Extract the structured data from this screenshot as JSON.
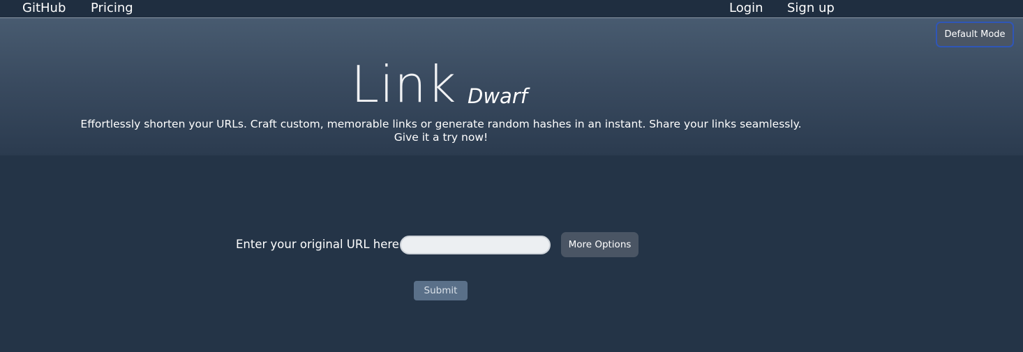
{
  "nav": {
    "left_links": [
      "GitHub",
      "Pricing"
    ],
    "right_links": [
      "Login",
      "Sign up"
    ]
  },
  "mode_button": {
    "label": "Default Mode"
  },
  "hero": {
    "logo_main": "Link",
    "logo_sub": "Dwarf",
    "tagline_line1": "Effortlessly shorten your URLs. Craft custom, memorable links or generate random hashes in an instant. Share your links seamlessly.",
    "tagline_line2": "Give it a try now!"
  },
  "form": {
    "url_label": "Enter your original URL here:",
    "url_value": "",
    "more_options_label": "More Options",
    "submit_label": "Submit"
  },
  "colors": {
    "page_background": "#243447",
    "nav_background": "#1f2e40",
    "button_background": "#4a5564",
    "submit_background": "#5a7089",
    "mode_button_border": "#2f56b8"
  }
}
